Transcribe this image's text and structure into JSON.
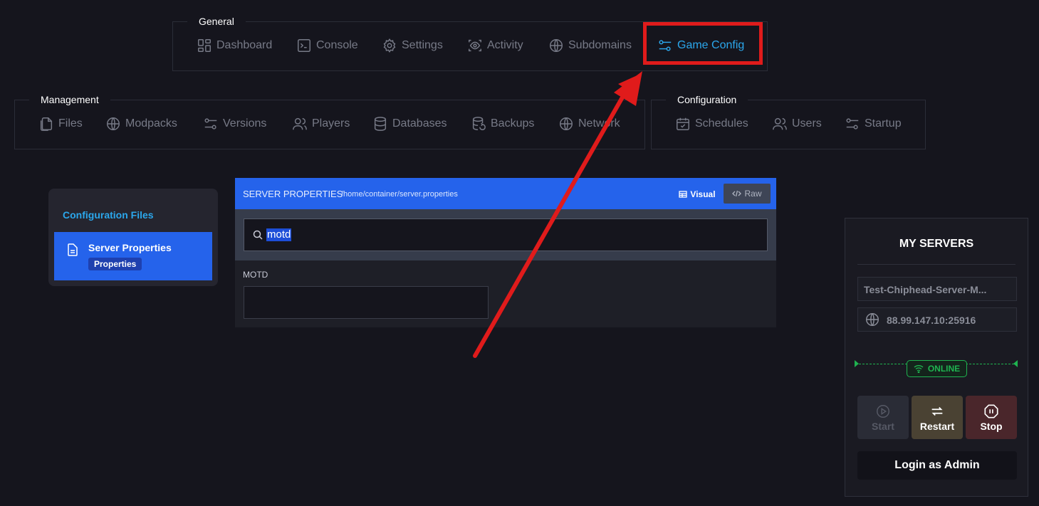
{
  "nav_groups": {
    "general": {
      "label": "General",
      "items": [
        {
          "label": "Dashboard",
          "icon": "dashboard-icon"
        },
        {
          "label": "Console",
          "icon": "terminal-icon"
        },
        {
          "label": "Settings",
          "icon": "gear-icon"
        },
        {
          "label": "Activity",
          "icon": "eye-icon"
        },
        {
          "label": "Subdomains",
          "icon": "globe-icon"
        },
        {
          "label": "Game Config",
          "icon": "sliders-icon",
          "active": true
        }
      ]
    },
    "management": {
      "label": "Management",
      "items": [
        {
          "label": "Files",
          "icon": "files-icon"
        },
        {
          "label": "Modpacks",
          "icon": "globe-icon"
        },
        {
          "label": "Versions",
          "icon": "sliders-icon"
        },
        {
          "label": "Players",
          "icon": "users-icon"
        },
        {
          "label": "Databases",
          "icon": "database-icon"
        },
        {
          "label": "Backups",
          "icon": "database-restore-icon"
        },
        {
          "label": "Network",
          "icon": "globe-icon"
        }
      ]
    },
    "configuration": {
      "label": "Configuration",
      "items": [
        {
          "label": "Schedules",
          "icon": "calendar-icon"
        },
        {
          "label": "Users",
          "icon": "users-icon"
        },
        {
          "label": "Startup",
          "icon": "sliders-icon"
        }
      ]
    }
  },
  "config_files": {
    "title": "Configuration Files",
    "items": [
      {
        "name": "Server Properties",
        "badge": "Properties",
        "selected": true
      }
    ]
  },
  "editor": {
    "title": "SERVER PROPERTIES",
    "path": "/home/container/server.properties",
    "visual_label": "Visual",
    "raw_label": "Raw",
    "search_value": "motd",
    "field_label": "MOTD",
    "field_value": ""
  },
  "servers": {
    "heading": "MY SERVERS",
    "server_name": "Test-Chiphead-Server-M...",
    "address": "88.99.147.10:25916",
    "status": "ONLINE",
    "buttons": {
      "start": "Start",
      "restart": "Restart",
      "stop": "Stop"
    },
    "login_label": "Login as Admin"
  },
  "colors": {
    "background": "#15151d",
    "accent_blue": "#2563eb",
    "active_nav": "#2ba7ec",
    "online_green": "#1fb350",
    "annotation_red": "#e01b1b"
  }
}
